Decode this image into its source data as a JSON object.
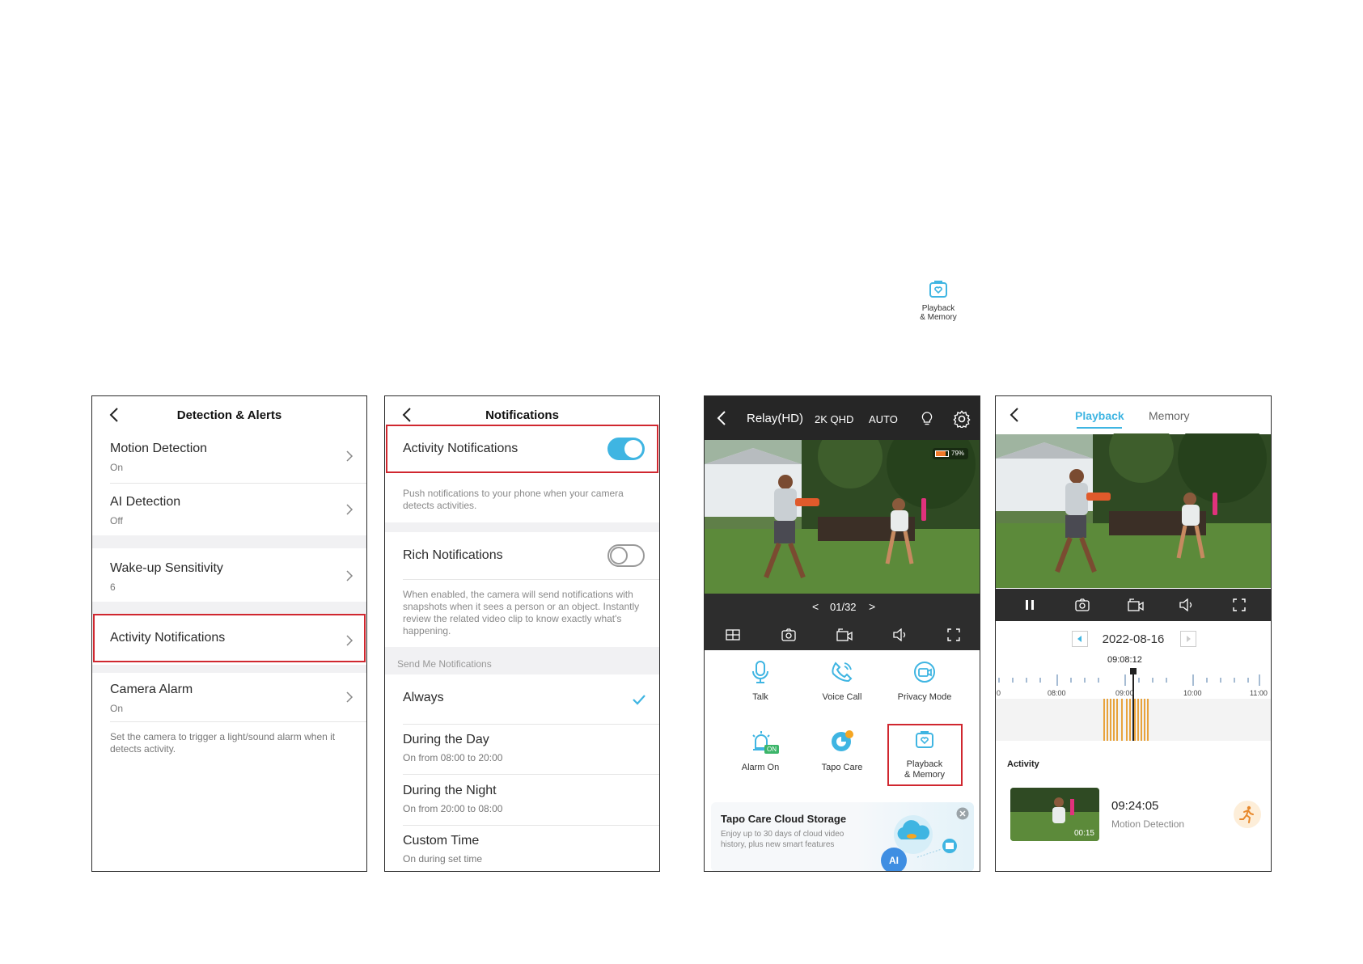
{
  "floating_icon": {
    "label_line1": "Playback",
    "label_line2": "& Memory"
  },
  "screen1": {
    "title": "Detection & Alerts",
    "items": [
      {
        "label": "Motion Detection",
        "value": "On"
      },
      {
        "label": "AI Detection",
        "value": "Off"
      },
      {
        "label": "Wake-up Sensitivity",
        "value": "6"
      },
      {
        "label": "Activity Notifications",
        "value": ""
      },
      {
        "label": "Camera Alarm",
        "value": "On"
      }
    ],
    "footer": "Set the camera to trigger a light/sound alarm when it detects activity."
  },
  "screen2": {
    "title": "Notifications",
    "activity_label": "Activity Notifications",
    "activity_desc": "Push notifications to your phone when your camera detects activities.",
    "rich_label": "Rich Notifications",
    "rich_desc": "When enabled, the camera will send notifications with snapshots when it sees a person or an object. Instantly review the related video clip to know exactly what's happening.",
    "section": "Send Me Notifications",
    "options": [
      {
        "label": "Always",
        "sub": ""
      },
      {
        "label": "During the Day",
        "sub": "On from 08:00 to 20:00"
      },
      {
        "label": "During the Night",
        "sub": "On from 20:00 to 08:00"
      },
      {
        "label": "Custom Time",
        "sub": "On during set time"
      }
    ],
    "activity_on": 1,
    "rich_on": 0
  },
  "screen3": {
    "device": "Relay(HD)",
    "quality": "2K QHD",
    "mode": "AUTO",
    "battery": "79%",
    "pager": "01/32",
    "controls": [
      {
        "label": "Talk",
        "icon": "microphone-icon"
      },
      {
        "label": "Voice Call",
        "icon": "phone-icon"
      },
      {
        "label": "Privacy Mode",
        "icon": "privacy-camera-icon"
      },
      {
        "label": "Alarm On",
        "icon": "alarm-icon"
      },
      {
        "label": "Tapo Care",
        "icon": "tapo-care-icon"
      },
      {
        "label": "Playback",
        "label2": "& Memory",
        "icon": "playback-icon"
      }
    ],
    "alarm_badge": "ON",
    "promo_title": "Tapo Care Cloud Storage",
    "promo_desc": "Enjoy up to 30 days of cloud video history, plus new smart features",
    "promo_ai": "AI"
  },
  "screen4": {
    "tabs": [
      "Playback",
      "Memory"
    ],
    "date": "2022-08-16",
    "cursor_time": "09:08:12",
    "ticks": [
      "0",
      "08:00",
      "09:00",
      "10:00",
      "11:00"
    ],
    "activity_heading": "Activity",
    "clip_duration": "00:15",
    "event_time": "09:24:05",
    "event_type": "Motion Detection",
    "colors": {
      "accent": "#3fb5e2",
      "event": "#e8a33c"
    }
  }
}
